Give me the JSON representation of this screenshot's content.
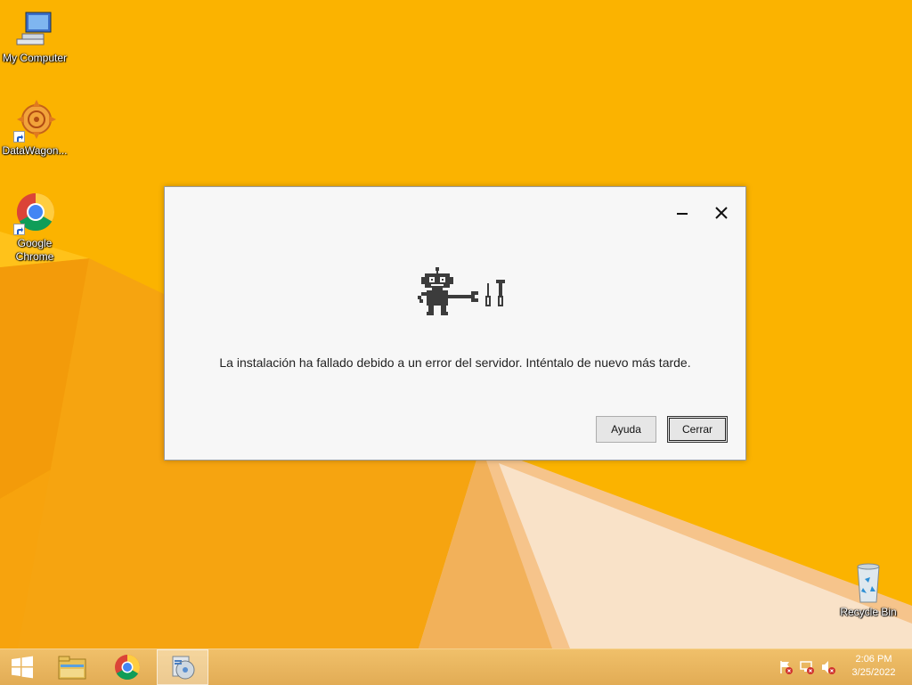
{
  "desktop": {
    "icons": [
      {
        "label": "My Computer"
      },
      {
        "label": "DataWagon..."
      },
      {
        "label": "Google Chrome"
      },
      {
        "label": "Recycle Bin"
      }
    ]
  },
  "dialog": {
    "message": "La instalación ha fallado debido a un error del servidor. Inténtalo de nuevo más tarde.",
    "help_label": "Ayuda",
    "close_label": "Cerrar"
  },
  "taskbar": {
    "items": [
      "start-icon",
      "file-explorer-icon",
      "chrome-icon",
      "setup-icon"
    ],
    "tray": [
      "action-center-flag-icon",
      "network-icon",
      "volume-muted-icon"
    ],
    "time": "2:06 PM",
    "date": "3/25/2022"
  },
  "colors": {
    "wallpaper": "#fbb300",
    "taskbar": "#e8b35c",
    "dialog_bg": "#f7f7f7"
  }
}
